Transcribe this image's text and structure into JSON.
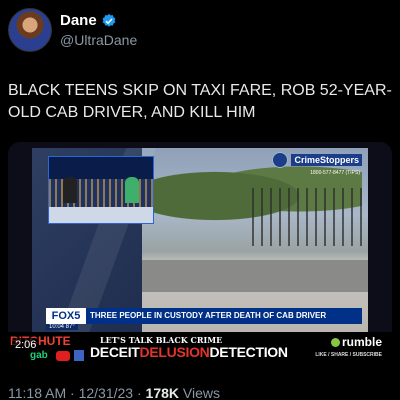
{
  "author": {
    "display_name": "Dane",
    "handle": "@UltraDane",
    "verified_icon": "verified-badge-icon"
  },
  "tweet": {
    "text": "BLACK TEENS SKIP ON TAXI FARE, ROB 52-YEAR-OLD CAB DRIVER, AND KILL HIM"
  },
  "video": {
    "duration": "2:06",
    "overlay": {
      "crime_stoppers_label": "CrimeStoppers",
      "crime_stoppers_phone": "1800-577-8477 (TIPS)",
      "channel_logo": "FOX5",
      "headline": "THREE PEOPLE IN CUSTODY AFTER DEATH OF CAB DRIVER",
      "clock": "10:04 87°"
    },
    "banner": {
      "bitchute": "BITCHUTE",
      "gab": "gab",
      "tagline": "LET'S TALK BLACK CRIME",
      "brand_a": "DECEIT",
      "brand_b": "DELUSION",
      "brand_c": "DETECTION",
      "rumble": "rumble",
      "share": "LIKE / SHARE / SUBSCRIBE"
    }
  },
  "meta": {
    "time": "11:18 AM",
    "separator": "·",
    "date": "12/31/23",
    "views_count": "178K",
    "views_label": "Views"
  },
  "colors": {
    "background": "#000000",
    "verified": "#1d9bf0",
    "secondary_text": "#8b98a5",
    "fox_blue": "#003087"
  }
}
